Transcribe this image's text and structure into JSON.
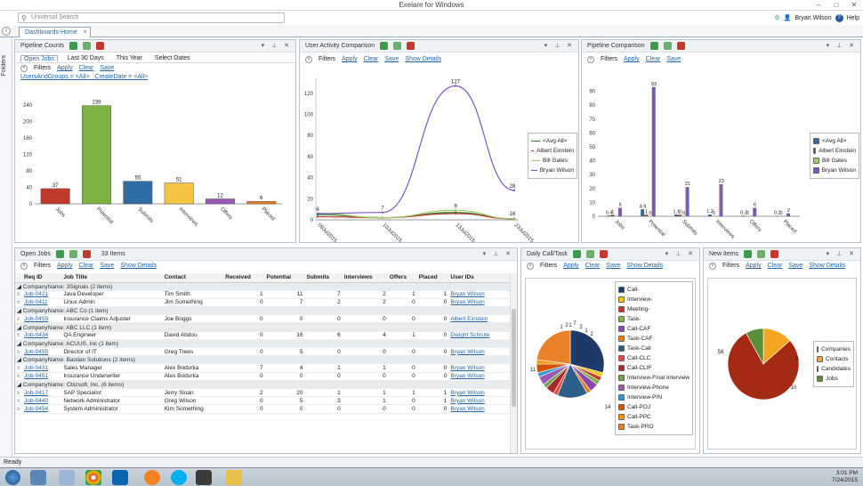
{
  "app": {
    "title": "Exelare for Windows"
  },
  "topbar": {
    "search_placeholder": "Universal Search",
    "user": "Bryan Wilson",
    "help": "Help"
  },
  "tabs": [
    {
      "label": "Dashboards-Home"
    }
  ],
  "leftrail": {
    "label": "Folders"
  },
  "common": {
    "filters": "Filters",
    "apply": "Apply",
    "clear": "Clear",
    "save": "Save",
    "show_details": "Show Details"
  },
  "pipeline_counts": {
    "title": "Pipeline Counts",
    "subtabs": [
      "Open Jobs",
      "Last 30 Days",
      "This Year",
      "Select Dates"
    ],
    "criteria": [
      "UsersAndGroups = <All>",
      "CreateDate = <All>"
    ],
    "chart_data": {
      "type": "bar",
      "categories": [
        "Jobs",
        "Potential",
        "Submits",
        "Interviews",
        "Offers",
        "Placed"
      ],
      "values": [
        37,
        239,
        55,
        51,
        12,
        6
      ],
      "colors": [
        "#c0392b",
        "#7cb342",
        "#2e6da4",
        "#f4c542",
        "#9b59b6",
        "#e67e22"
      ],
      "yticks": [
        0,
        40,
        80,
        120,
        160,
        200,
        240
      ],
      "ylim": [
        0,
        260
      ]
    }
  },
  "user_activity": {
    "title": "User Activity Comparison",
    "chart_data": {
      "type": "line",
      "x": [
        "09Jul2015",
        "10Jul2015",
        "13Jul2015",
        "23Jul2015"
      ],
      "yticks": [
        0,
        20,
        40,
        60,
        80,
        100,
        120
      ],
      "ylim": [
        0,
        135
      ],
      "series": [
        {
          "name": "<Avg All>",
          "color": "#2e7d32",
          "values": [
            5,
            2,
            7,
            1
          ]
        },
        {
          "name": "Albert Einstein",
          "color": "#c0392b",
          "values": [
            3,
            2,
            6,
            1
          ]
        },
        {
          "name": "Bill Gates",
          "color": "#9ccc65",
          "values": [
            6,
            2,
            9,
            1
          ]
        },
        {
          "name": "Bryan Wilson",
          "color": "#7e57c2",
          "values": [
            6,
            7,
            127,
            28
          ]
        }
      ],
      "labels": [
        {
          "text": "127"
        },
        {
          "text": "28"
        },
        {
          "text": "7"
        },
        {
          "text": "6"
        },
        {
          "text": "9"
        },
        {
          "text": "16"
        }
      ]
    }
  },
  "pipeline_comparison": {
    "title": "Pipeline Comparison",
    "chart_data": {
      "type": "bar",
      "categories": [
        "Jobs",
        "Potential",
        "Submits",
        "Interviews",
        "Offers",
        "Placed"
      ],
      "yticks": [
        0,
        10,
        20,
        30,
        40,
        50,
        60,
        70,
        80,
        90
      ],
      "ylim": [
        0,
        100
      ],
      "series": [
        {
          "name": "<Avg All>",
          "color": "#2e6da4",
          "values": [
            0.4,
            4.9,
            1.1,
            1.2,
            0.3,
            0.2
          ]
        },
        {
          "name": "Albert Einstein",
          "color": "#c0392b",
          "values": [
            1,
            1,
            1,
            0,
            0,
            0
          ]
        },
        {
          "name": "Bill Gates",
          "color": "#9ccc65",
          "values": [
            0,
            0,
            0,
            0,
            0,
            0
          ]
        },
        {
          "name": "Bryan Wilson",
          "color": "#7e57c2",
          "values": [
            6,
            93,
            21,
            23,
            6,
            2
          ]
        }
      ],
      "data_labels": [
        [
          "0.4",
          "1",
          "",
          "6"
        ],
        [
          "4.9",
          "1",
          "0",
          "93"
        ],
        [
          "1.1",
          "0",
          "0",
          "21"
        ],
        [
          "1.2",
          "0",
          "",
          "23"
        ],
        [
          "0.3",
          "0",
          "",
          "6"
        ],
        [
          "0.2",
          "0",
          "",
          "2"
        ]
      ]
    }
  },
  "open_jobs": {
    "title": "Open Jobs",
    "count": "33 Items",
    "columns": [
      "Req ID",
      "Job Title",
      "Contact",
      "Received",
      "Potential",
      "Submits",
      "Interviews",
      "Offers",
      "Placed",
      "User IDs"
    ],
    "rows": [
      {
        "group": "CompanyName: 3Signals (2 items)"
      },
      {
        "id": "Job-0421",
        "title": "Java Developer",
        "contact": "Tim Smith",
        "received": "1",
        "potential": "11",
        "submits": "7",
        "interviews": "2",
        "offers": "1",
        "placed": "1",
        "user": "Bryan Wilson"
      },
      {
        "id": "Job-0411",
        "title": "Linux Admin",
        "contact": "Jim Something",
        "received": "0",
        "potential": "7",
        "submits": "2",
        "interviews": "2",
        "offers": "0",
        "placed": "0",
        "user": "Bryan Wilson"
      },
      {
        "group": "CompanyName: ABC Co (1 item)"
      },
      {
        "id": "Job-0459",
        "title": "Insurance Claims Adjuster",
        "contact": "Joe Boggs",
        "received": "0",
        "potential": "0",
        "submits": "0",
        "interviews": "0",
        "offers": "0",
        "placed": "0",
        "user": "Albert Einstein"
      },
      {
        "group": "CompanyName: ABC LLC (1 item)"
      },
      {
        "id": "Job-0434",
        "title": "QA Engineer",
        "contact": "David Abdou",
        "received": "0",
        "potential": "16",
        "submits": "6",
        "interviews": "4",
        "offers": "1",
        "placed": "0",
        "user": "Dwight Schrute"
      },
      {
        "group": "CompanyName: ACUUS, Inc (1 item)"
      },
      {
        "id": "Job-0455",
        "title": "Director of IT",
        "contact": "Greg Trees",
        "received": "0",
        "potential": "5",
        "submits": "0",
        "interviews": "0",
        "offers": "0",
        "placed": "0",
        "user": "Bryan Wilson"
      },
      {
        "group": "CompanyName: Bastian Solutions (2 items)"
      },
      {
        "id": "Job-0431",
        "title": "Sales Manager",
        "contact": "Alex Bodurka",
        "received": "7",
        "potential": "4",
        "submits": "1",
        "interviews": "1",
        "offers": "0",
        "placed": "0",
        "user": "Bryan Wilson"
      },
      {
        "id": "Job-0451",
        "title": "Insurance Underwriter",
        "contact": "Alex Bodurka",
        "received": "0",
        "potential": "0",
        "submits": "0",
        "interviews": "0",
        "offers": "0",
        "placed": "0",
        "user": "Bryan Wilson"
      },
      {
        "group": "CompanyName: Cbizsoft, Inc. (6 items)"
      },
      {
        "id": "Job-0417",
        "title": "SAP Specialist",
        "contact": "Jerry Sloan",
        "received": "2",
        "potential": "20",
        "submits": "1",
        "interviews": "1",
        "offers": "1",
        "placed": "1",
        "user": "Bryan Wilson"
      },
      {
        "id": "Job-0440",
        "title": "Network Administrator",
        "contact": "Greg Wilson",
        "received": "0",
        "potential": "5",
        "submits": "3",
        "interviews": "1",
        "offers": "0",
        "placed": "1",
        "user": "Bryan Wilson"
      },
      {
        "id": "Job-0454",
        "title": "System Administrator",
        "contact": "Kim Something",
        "received": "0",
        "potential": "0",
        "submits": "0",
        "interviews": "0",
        "offers": "0",
        "placed": "0",
        "user": "Bryan Wilson"
      }
    ]
  },
  "daily_call": {
    "title": "Daily Call/Task",
    "chart_data": {
      "type": "pie",
      "slices": [
        {
          "label": "Call-",
          "value": 14,
          "color": "#1f3a68"
        },
        {
          "label": "Interview-",
          "value": 1,
          "color": "#f0c419"
        },
        {
          "label": "Meeting-",
          "value": 1,
          "color": "#c0392b"
        },
        {
          "label": "Task-",
          "value": 1,
          "color": "#7cb342"
        },
        {
          "label": "Call-CAF",
          "value": 2,
          "color": "#8e44ad"
        },
        {
          "label": "Task-CAF",
          "value": 1,
          "color": "#e67e22"
        },
        {
          "label": "Task-Call",
          "value": 7,
          "color": "#2c5f8a"
        },
        {
          "label": "Call-CLC",
          "value": 1,
          "color": "#e74c3c"
        },
        {
          "label": "Call-CLIF",
          "value": 2,
          "color": "#a52a2a"
        },
        {
          "label": "Interview-Final Interview",
          "value": 1,
          "color": "#6aa84f"
        },
        {
          "label": "Interview-Phone",
          "value": 2,
          "color": "#9b59b6"
        },
        {
          "label": "Interview-PIN",
          "value": 1,
          "color": "#3498db"
        },
        {
          "label": "Call-POJ",
          "value": 2,
          "color": "#d35400"
        },
        {
          "label": "Call-PPC",
          "value": 1,
          "color": "#f39c12"
        },
        {
          "label": "Task-PRO",
          "value": 11,
          "color": "#e8812a"
        }
      ],
      "data_labels": [
        "14",
        "11",
        "7",
        "1",
        "2",
        "1",
        "2",
        "1",
        "2"
      ]
    }
  },
  "new_items": {
    "title": "New Items",
    "chart_data": {
      "type": "pie",
      "slices": [
        {
          "label": "Companies",
          "value": 0,
          "color": "#1f3a68"
        },
        {
          "label": "Contacts",
          "value": 10,
          "color": "#f4a623"
        },
        {
          "label": "Candidates",
          "value": 58,
          "color": "#a52a14"
        },
        {
          "label": "Jobs",
          "value": 6,
          "color": "#5b8c3a"
        }
      ],
      "data_labels": [
        "58",
        "10",
        "6"
      ]
    }
  },
  "status": {
    "text": "Ready"
  },
  "taskbar": {
    "time": "3:01 PM",
    "date": "7/24/2015"
  }
}
